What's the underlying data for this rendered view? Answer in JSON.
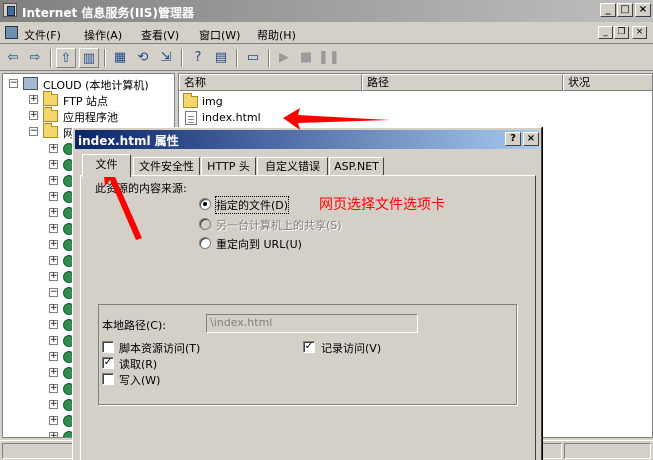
{
  "window": {
    "title": "Internet 信息服务(IIS)管理器",
    "controls": {
      "minimize": "_",
      "maximize": "□",
      "close": "×"
    }
  },
  "menubar": {
    "items": [
      "文件(F)",
      "操作(A)",
      "查看(V)",
      "窗口(W)",
      "帮助(H)"
    ],
    "mdi_controls": {
      "minimize": "_",
      "restore": "❐",
      "close": "×"
    }
  },
  "toolbar": {
    "icons": [
      "back-arrow-icon",
      "forward-arrow-icon",
      "up-folder-icon",
      "show-tree-icon",
      "properties-icon",
      "refresh-icon",
      "export-icon",
      "help-icon",
      "console-icon",
      "computer-icon",
      "play-icon",
      "stop-icon",
      "pause-icon"
    ],
    "glyphs": {
      "back": "⇦",
      "forward": "⇨",
      "up": "⇧",
      "tree": "▥",
      "props": "▦",
      "refresh": "⟲",
      "export": "⇲",
      "help": "?",
      "console": "▤",
      "computer": "▭",
      "play": "▶",
      "stop": "■",
      "pause": "❚❚"
    }
  },
  "tree": {
    "root": "CLOUD (本地计算机)",
    "items": [
      {
        "label": "FTP 站点"
      },
      {
        "label": "应用程序池"
      },
      {
        "label": "网"
      }
    ]
  },
  "list": {
    "columns": [
      "名称",
      "路径",
      "状况"
    ],
    "rows": [
      {
        "name": "img",
        "type": "folder"
      },
      {
        "name": "index.html",
        "type": "file"
      }
    ]
  },
  "dialog": {
    "title": "index.html 属性",
    "help_button": "?",
    "close_button": "×",
    "tabs": [
      "文件",
      "文件安全性",
      "HTTP 头",
      "自定义错误",
      "ASP.NET"
    ],
    "active_tab": 0,
    "content_source_label": "此资源的内容来源:",
    "content_source_label_visible": "此资源的内容来源:",
    "options": [
      {
        "label": "指定的文件(D)",
        "selected": true,
        "disabled": false
      },
      {
        "label": "另一台计算机上的共享(S)",
        "selected": false,
        "disabled": true
      },
      {
        "label": "重定向到 URL(U)",
        "selected": false,
        "disabled": false
      }
    ],
    "local_path_label": "本地路径(C):",
    "local_path_value": "\\index.html",
    "checkboxes": [
      {
        "label": "脚本资源访问(T)",
        "checked": false
      },
      {
        "label": "读取(R)",
        "checked": true
      },
      {
        "label": "写入(W)",
        "checked": false
      },
      {
        "label": "记录访问(V)",
        "checked": true
      }
    ],
    "check_mark": "✓"
  },
  "annotation": {
    "text": "网页选择文件选项卡",
    "color": "#ff0000"
  }
}
